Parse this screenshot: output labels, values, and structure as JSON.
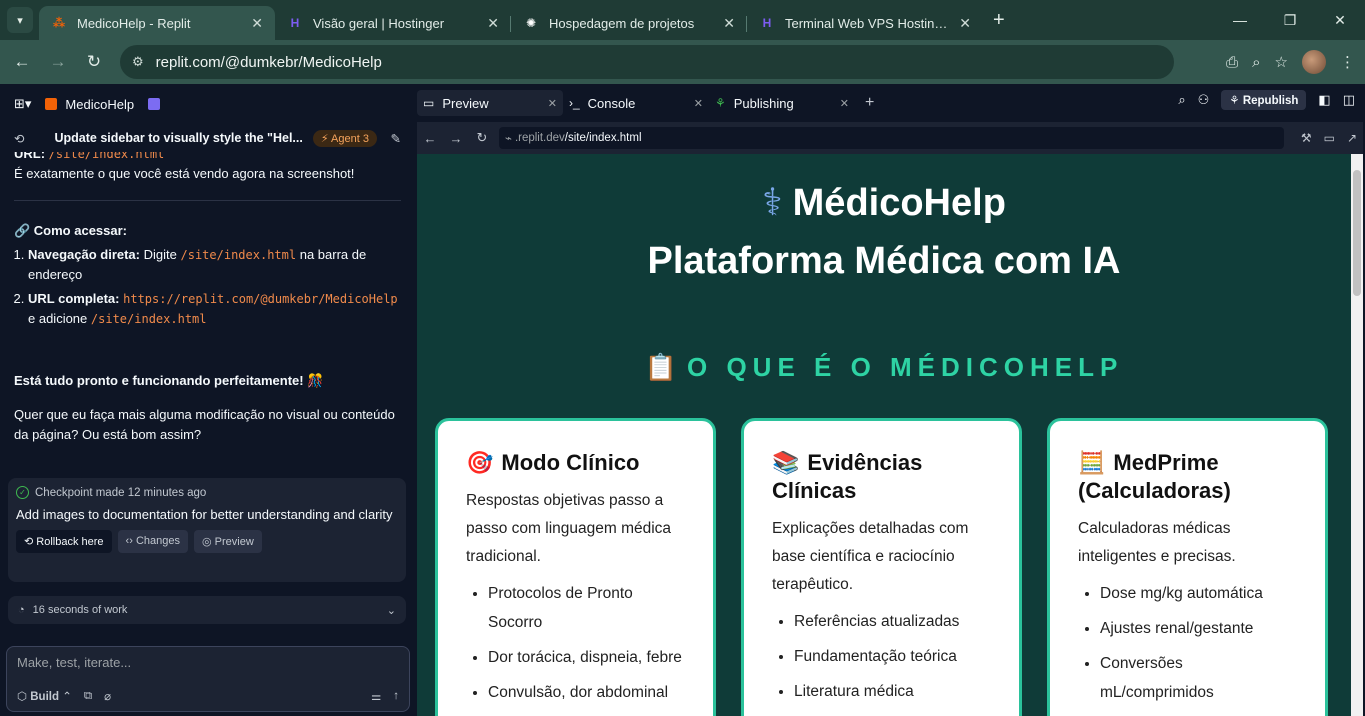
{
  "browser": {
    "tabs": [
      {
        "title": "MedicoHelp - Replit",
        "icon": "replit-icon",
        "color": "#f26207",
        "active": true
      },
      {
        "title": "Visão geral | Hostinger",
        "icon": "hostinger-icon",
        "color": "#673de6",
        "active": false
      },
      {
        "title": "Hospedagem de projetos",
        "icon": "openai-icon",
        "color": "#ffffff",
        "active": false
      },
      {
        "title": "Terminal Web VPS Hostinger",
        "icon": "hostinger-icon",
        "color": "#673de6",
        "active": false
      }
    ],
    "url": "replit.com/@dumkebr/MedicoHelp"
  },
  "agent": {
    "project_name": "MedicoHelp",
    "thread_title": "Update sidebar to visually style the \"Hel...",
    "agent_badge": "Agent 3",
    "messages": {
      "url_label": "URL:",
      "url_code": "/site/index.html",
      "line1": "É exatamente o que você está vendo agora na screenshot!",
      "how_title": "🔗 Como acessar:",
      "step1_bold": "Navegação direta:",
      "step1_pre": "Digite",
      "step1_code": "/site/index.html",
      "step1_post": "na barra de endereço",
      "step2_bold": "URL completa:",
      "step2_code": "https://replit.com/@dumkebr/MedicoHelp",
      "step2_pre": "e adicione",
      "step2_code2": "/site/index.html",
      "ready": "Está tudo pronto e funcionando perfeitamente! 🎊",
      "question": "Quer que eu faça mais alguma modificação no visual ou conteúdo da página? Ou está bom assim?"
    },
    "checkpoint": {
      "label": "Checkpoint made 12 minutes ago",
      "text": "Add images to documentation for better understanding and clarity",
      "rollback": "Rollback here",
      "changes": "Changes",
      "preview": "Preview"
    },
    "work_summary": "16 seconds of work",
    "input_placeholder": "Make, test, iterate...",
    "build_label": "Build"
  },
  "workspace": {
    "tabs": [
      {
        "label": "Preview"
      },
      {
        "label": "Console"
      },
      {
        "label": "Publishing"
      }
    ],
    "republish": "Republish",
    "frame_url_host": ".replit.dev",
    "frame_url_path": "/site/index.html"
  },
  "site": {
    "title_line1": "MédicoHelp",
    "title_line2": "Plataforma Médica com IA",
    "section_title": "O QUE É O MÉDICOHELP",
    "cards": [
      {
        "emoji": "🎯",
        "title": "Modo Clínico",
        "desc": "Respostas objetivas passo a passo com linguagem médica tradicional.",
        "items": [
          "Protocolos de Pronto Socorro",
          "Dor torácica, dispneia, febre",
          "Convulsão, dor abdominal"
        ]
      },
      {
        "emoji": "📚",
        "title": "Evidências Clínicas",
        "desc": "Explicações detalhadas com base científica e raciocínio terapêutico.",
        "items": [
          "Referências atualizadas",
          "Fundamentação teórica",
          "Literatura médica"
        ]
      },
      {
        "emoji": "🧮",
        "title": "MedPrime (Calculadoras)",
        "desc": "Calculadoras médicas inteligentes e precisas.",
        "items": [
          "Dose mg/kg automática",
          "Ajustes renal/gestante",
          "Conversões mL/comprimidos"
        ]
      }
    ]
  }
}
